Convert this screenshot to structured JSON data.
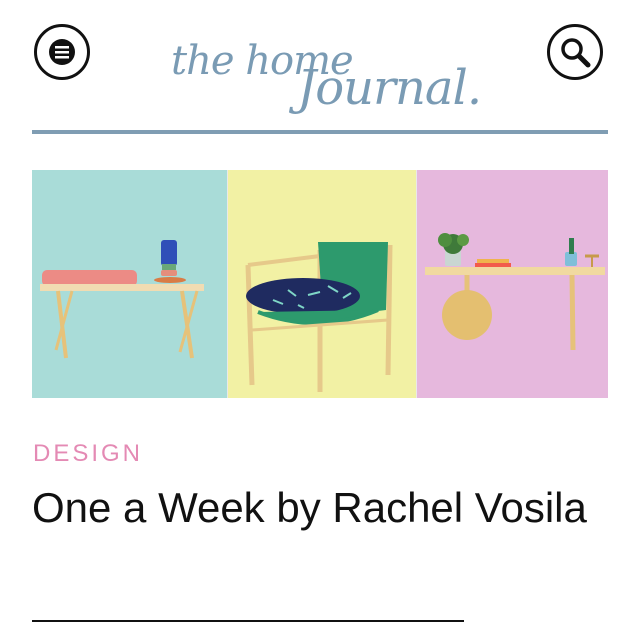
{
  "header": {
    "menu_icon": "hamburger-menu-icon",
    "search_icon": "search-icon",
    "logo_line1": "the home",
    "logo_line2": "Journal."
  },
  "hero": {
    "panels": [
      {
        "name": "bench-with-cushion",
        "bg": "#a9dcd8"
      },
      {
        "name": "green-sling-chair",
        "bg": "#f2f1a4"
      },
      {
        "name": "wheel-table",
        "bg": "#e6b8dd"
      }
    ]
  },
  "article": {
    "category": "DESIGN",
    "title": "One a Week by Rachel Vosila"
  },
  "colors": {
    "accent_blue": "#7f9db3",
    "category_pink": "#e48ab4",
    "text": "#111111"
  }
}
